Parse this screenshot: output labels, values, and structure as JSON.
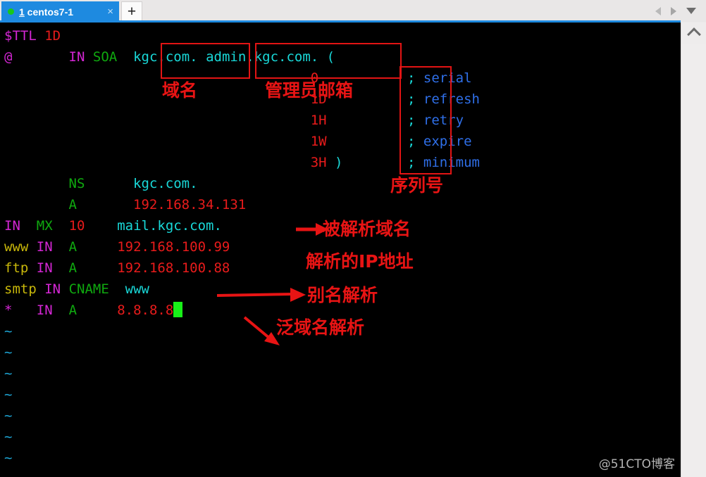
{
  "window": {
    "tab": {
      "index": "1",
      "title": " centos7-1",
      "close_glyph": "×",
      "new_tab_glyph": "+",
      "status_color": "#18c81c",
      "active_color": "#1e8ae0"
    },
    "toolbar": {
      "prev_label": "previous-tab",
      "next_label": "next-tab",
      "menu_label": "tab-menu"
    },
    "scrollbar": {
      "up_label": "scroll-up"
    }
  },
  "terminal": {
    "lines": [
      {
        "id": "line-ttl",
        "segments": [
          {
            "text": "$TTL",
            "color": "magenta"
          },
          {
            "text": " ",
            "color": "plain"
          },
          {
            "text": "1D",
            "color": "red"
          }
        ]
      },
      {
        "id": "line-soa",
        "segments": [
          {
            "text": "@",
            "color": "magenta"
          },
          {
            "text": "       ",
            "color": "plain"
          },
          {
            "text": "IN",
            "color": "magenta"
          },
          {
            "text": " ",
            "color": "plain"
          },
          {
            "text": "SOA",
            "color": "green"
          },
          {
            "text": "  ",
            "color": "plain"
          },
          {
            "text": "kgc.com.",
            "color": "cyan"
          },
          {
            "text": " ",
            "color": "plain"
          },
          {
            "text": "admin.kgc.com.",
            "color": "cyan"
          },
          {
            "text": " ",
            "color": "plain"
          },
          {
            "text": "(",
            "color": "cyan"
          }
        ]
      },
      {
        "id": "line-serial",
        "segments": [
          {
            "text": "                                      ",
            "color": "plain"
          },
          {
            "text": "0",
            "color": "red"
          },
          {
            "text": "           ",
            "color": "plain"
          },
          {
            "text": ";",
            "color": "cyan"
          },
          {
            "text": " ",
            "color": "plain"
          },
          {
            "text": "serial",
            "color": "blue"
          }
        ]
      },
      {
        "id": "line-refresh",
        "segments": [
          {
            "text": "                                      ",
            "color": "plain"
          },
          {
            "text": "1D",
            "color": "red"
          },
          {
            "text": "          ",
            "color": "plain"
          },
          {
            "text": ";",
            "color": "cyan"
          },
          {
            "text": " ",
            "color": "plain"
          },
          {
            "text": "refresh",
            "color": "blue"
          }
        ]
      },
      {
        "id": "line-retry",
        "segments": [
          {
            "text": "                                      ",
            "color": "plain"
          },
          {
            "text": "1H",
            "color": "red"
          },
          {
            "text": "          ",
            "color": "plain"
          },
          {
            "text": ";",
            "color": "cyan"
          },
          {
            "text": " ",
            "color": "plain"
          },
          {
            "text": "retry",
            "color": "blue"
          }
        ]
      },
      {
        "id": "line-expire",
        "segments": [
          {
            "text": "                                      ",
            "color": "plain"
          },
          {
            "text": "1W",
            "color": "red"
          },
          {
            "text": "          ",
            "color": "plain"
          },
          {
            "text": ";",
            "color": "cyan"
          },
          {
            "text": " ",
            "color": "plain"
          },
          {
            "text": "expire",
            "color": "blue"
          }
        ]
      },
      {
        "id": "line-minimum",
        "segments": [
          {
            "text": "                                      ",
            "color": "plain"
          },
          {
            "text": "3H",
            "color": "red"
          },
          {
            "text": " ",
            "color": "plain"
          },
          {
            "text": ")",
            "color": "cyan"
          },
          {
            "text": "        ",
            "color": "plain"
          },
          {
            "text": ";",
            "color": "cyan"
          },
          {
            "text": " ",
            "color": "plain"
          },
          {
            "text": "minimum",
            "color": "blue"
          }
        ]
      },
      {
        "id": "line-ns",
        "segments": [
          {
            "text": "        ",
            "color": "plain"
          },
          {
            "text": "NS",
            "color": "green"
          },
          {
            "text": "      ",
            "color": "plain"
          },
          {
            "text": "kgc.com.",
            "color": "cyan"
          }
        ]
      },
      {
        "id": "line-a-ns",
        "segments": [
          {
            "text": "        ",
            "color": "plain"
          },
          {
            "text": "A",
            "color": "green"
          },
          {
            "text": "       ",
            "color": "plain"
          },
          {
            "text": "192.168.34.131",
            "color": "red"
          }
        ]
      },
      {
        "id": "line-mx",
        "segments": [
          {
            "text": "IN",
            "color": "magenta"
          },
          {
            "text": "  ",
            "color": "plain"
          },
          {
            "text": "MX",
            "color": "green"
          },
          {
            "text": "  ",
            "color": "plain"
          },
          {
            "text": "10",
            "color": "red"
          },
          {
            "text": "    ",
            "color": "plain"
          },
          {
            "text": "mail.kgc.com.",
            "color": "cyan"
          }
        ]
      },
      {
        "id": "line-www",
        "segments": [
          {
            "text": "www",
            "color": "yellow"
          },
          {
            "text": " ",
            "color": "plain"
          },
          {
            "text": "IN",
            "color": "magenta"
          },
          {
            "text": "  ",
            "color": "plain"
          },
          {
            "text": "A",
            "color": "green"
          },
          {
            "text": "     ",
            "color": "plain"
          },
          {
            "text": "192.168.100.99",
            "color": "red"
          }
        ]
      },
      {
        "id": "line-ftp",
        "segments": [
          {
            "text": "ftp",
            "color": "yellow"
          },
          {
            "text": " ",
            "color": "plain"
          },
          {
            "text": "IN",
            "color": "magenta"
          },
          {
            "text": "  ",
            "color": "plain"
          },
          {
            "text": "A",
            "color": "green"
          },
          {
            "text": "     ",
            "color": "plain"
          },
          {
            "text": "192.168.100.88",
            "color": "red"
          }
        ]
      },
      {
        "id": "line-smtp",
        "segments": [
          {
            "text": "smtp",
            "color": "yellow"
          },
          {
            "text": " ",
            "color": "plain"
          },
          {
            "text": "IN",
            "color": "magenta"
          },
          {
            "text": " ",
            "color": "plain"
          },
          {
            "text": "CNAME",
            "color": "green"
          },
          {
            "text": "  ",
            "color": "plain"
          },
          {
            "text": "www",
            "color": "cyan"
          }
        ]
      },
      {
        "id": "line-wildcard",
        "segments": [
          {
            "text": "*",
            "color": "magenta"
          },
          {
            "text": "   ",
            "color": "plain"
          },
          {
            "text": "IN",
            "color": "magenta"
          },
          {
            "text": "  ",
            "color": "plain"
          },
          {
            "text": "A",
            "color": "green"
          },
          {
            "text": "     ",
            "color": "plain"
          },
          {
            "text": "8.8.8.8",
            "color": "red"
          }
        ]
      }
    ],
    "empty_marker": "~",
    "empty_marker_count": 7,
    "cursor": {
      "color": "#18f018",
      "after_line": "line-wildcard"
    }
  },
  "annotations": {
    "color": "#e81414",
    "boxes": [
      {
        "name": "domain-name-box",
        "label": "kgc.com. highlight"
      },
      {
        "name": "admin-email-box",
        "label": "admin.kgc.com. highlight"
      },
      {
        "name": "serial-values-box",
        "label": "SOA timer values highlight"
      }
    ],
    "labels": [
      {
        "id": "anno-domain",
        "text": "域名"
      },
      {
        "id": "anno-admin",
        "text": "管理员邮箱"
      },
      {
        "id": "anno-serial",
        "text": "序列号"
      },
      {
        "id": "anno-resolved",
        "text": "被解析域名"
      },
      {
        "id": "anno-ip",
        "text": "解析的IP地址"
      },
      {
        "id": "anno-alias",
        "text": "别名解析"
      },
      {
        "id": "anno-wildcard",
        "text": "泛域名解析"
      }
    ]
  },
  "watermark": {
    "text": "@51CTO博客"
  }
}
